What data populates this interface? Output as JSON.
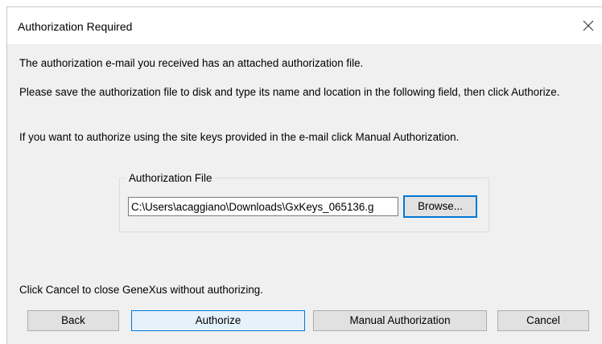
{
  "window": {
    "title": "Authorization Required",
    "close_icon": "close-icon"
  },
  "messages": {
    "line1": "The authorization e-mail you received has an attached authorization file.",
    "line2": "Please save the authorization file to disk and type its name and location in the following field, then click Authorize.",
    "line3": "If you want to authorize using the site keys provided in the e-mail click Manual Authorization.",
    "cancel_hint": "Click Cancel to close GeneXus without authorizing."
  },
  "authorization_file": {
    "legend": "Authorization File",
    "value": "C:\\Users\\acaggiano\\Downloads\\GxKeys_065136.g",
    "browse_label": "Browse..."
  },
  "buttons": {
    "back": "Back",
    "authorize": "Authorize",
    "manual": "Manual Authorization",
    "cancel": "Cancel"
  },
  "colors": {
    "dialog_background": "#f0f0f0",
    "focus_accent": "#0078d7",
    "default_button_background": "#e5f1fb",
    "button_background": "#e1e1e1"
  }
}
